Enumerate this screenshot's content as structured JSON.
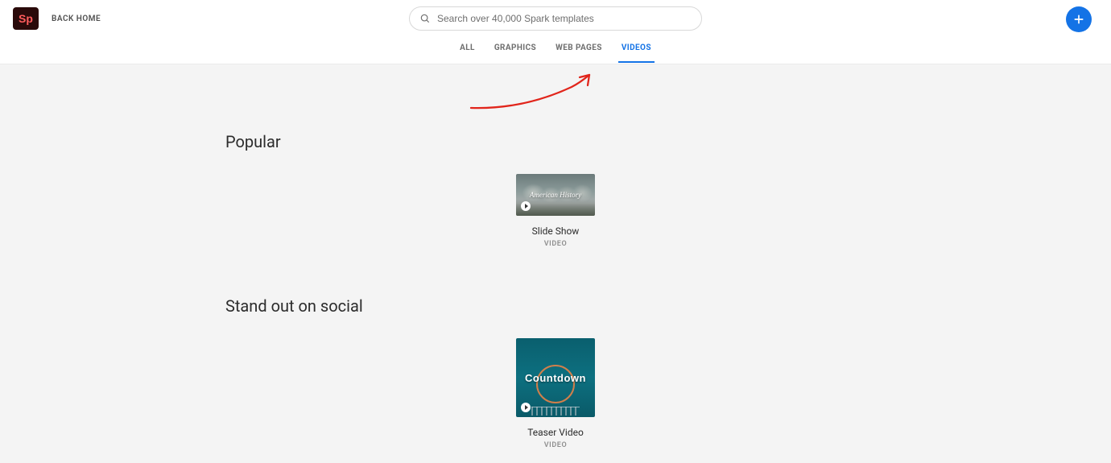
{
  "header": {
    "logo_text": "Sp",
    "back_home": "BACK HOME",
    "search_placeholder": "Search over 40,000 Spark templates",
    "tabs": [
      {
        "label": "ALL",
        "active": false
      },
      {
        "label": "GRAPHICS",
        "active": false
      },
      {
        "label": "WEB PAGES",
        "active": false
      },
      {
        "label": "VIDEOS",
        "active": true
      }
    ]
  },
  "annotation": {
    "type": "arrow",
    "color": "#e1251b",
    "points_to": "tab-videos"
  },
  "sections": [
    {
      "title": "Popular",
      "cards": [
        {
          "thumb_overlay": "American History",
          "title": "Slide Show",
          "subtitle": "VIDEO",
          "thumb_style": "rushmore"
        }
      ]
    },
    {
      "title": "Stand out on social",
      "cards": [
        {
          "thumb_overlay": "Countdown",
          "title": "Teaser Video",
          "subtitle": "VIDEO",
          "thumb_style": "hoop"
        }
      ]
    }
  ]
}
